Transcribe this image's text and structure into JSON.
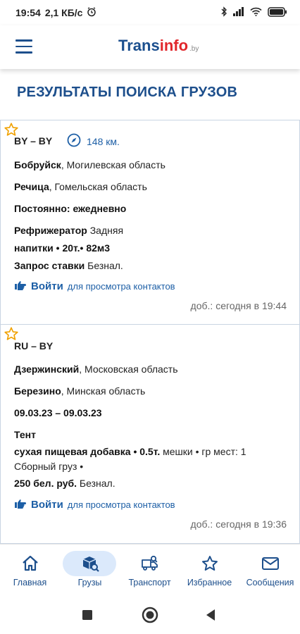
{
  "status_bar": {
    "time": "19:54",
    "net_speed": "2,1 КБ/с",
    "icons": [
      "alarm-icon",
      "bluetooth-icon",
      "signal-icon",
      "wifi-icon",
      "battery-icon"
    ],
    "battery_level": "95"
  },
  "header": {
    "logo_main": "Trans",
    "logo_accent": "info",
    "logo_suffix": ".by",
    "brand_blue": "#1b4f8e",
    "brand_red": "#e1262b"
  },
  "page": {
    "title": "РЕЗУЛЬТАТЫ ПОИСКА ГРУЗОВ"
  },
  "results": [
    {
      "route": "BY – BY",
      "distance": "148 км.",
      "from_city": "Бобруйск",
      "from_region": ", Могилевская область",
      "to_city": "Речица",
      "to_region": ", Гомельская область",
      "schedule_label": "Постоянно",
      "schedule_value": ": ежедневно",
      "truck_type": "Рефрижератор",
      "truck_load": " Задняя",
      "cargo": "напитки • 20т.• 82м3",
      "price_label": "Запрос ставки",
      "price_payment": " Безнал.",
      "login_label": "Войти",
      "login_hint": "для просмотра контактов",
      "added": "доб.: сегодня в 19:44"
    },
    {
      "route": "RU – BY",
      "from_city": "Дзержинский",
      "from_region": ", Московская область",
      "to_city": "Березино",
      "to_region": ", Минская область",
      "dates": "09.03.23 – 09.03.23",
      "truck_type": "Тент",
      "cargo_bold": "сухая пищевая добавка • 0.5т.",
      "cargo_rest": " мешки • гр мест: 1",
      "cargo_line2": "Сборный груз  •",
      "price_label": "250 бел. руб.",
      "price_payment": " Безнал.",
      "login_label": "Войти",
      "login_hint": "для просмотра контактов",
      "added": "доб.: сегодня в 19:36"
    }
  ],
  "bottom_nav": [
    {
      "label": "Главная",
      "icon": "home-icon"
    },
    {
      "label": "Грузы",
      "icon": "cargo-search-icon",
      "active": true
    },
    {
      "label": "Транспорт",
      "icon": "truck-search-icon"
    },
    {
      "label": "Избранное",
      "icon": "star-icon"
    },
    {
      "label": "Сообщения",
      "icon": "mail-icon"
    }
  ]
}
